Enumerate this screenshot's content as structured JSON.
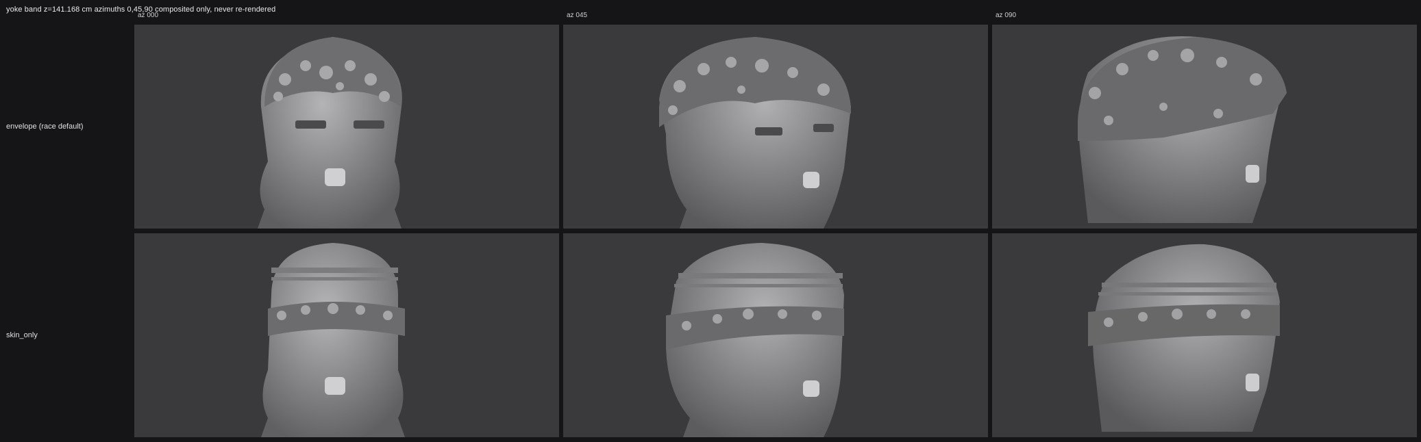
{
  "header": {
    "caption": "yoke band z=141.168 cm   azimuths 0,45,90   composited only, never re-rendered"
  },
  "columns": [
    {
      "label": "az 000"
    },
    {
      "label": "az 045"
    },
    {
      "label": "az 090"
    }
  ],
  "rows": [
    {
      "label": "envelope (race default)"
    },
    {
      "label": "skin_only"
    }
  ],
  "colors": {
    "background": "#151517",
    "panel": "#3a3a3c",
    "mesh": "#8e8e90"
  }
}
